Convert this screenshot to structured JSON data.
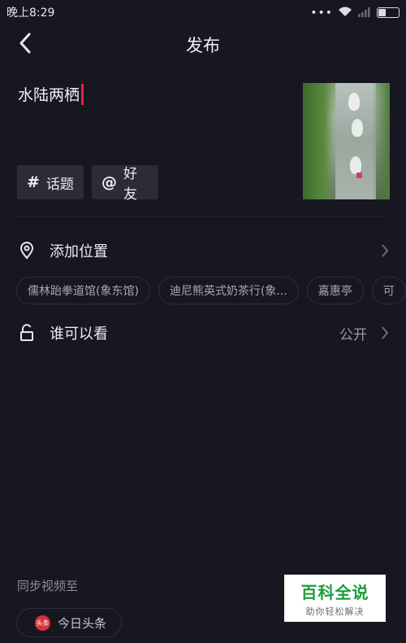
{
  "status_bar": {
    "time": "晚上8:29",
    "dots": "•••"
  },
  "header": {
    "title": "发布"
  },
  "caption": {
    "text": "水陆两栖"
  },
  "tags": {
    "topic_symbol": "#",
    "topic_label": "话题",
    "friend_symbol": "@",
    "friend_label": "好友"
  },
  "location": {
    "label": "添加位置",
    "suggestions": [
      "儒林跆拳道馆(象东馆)",
      "迪尼熊英式奶茶行(象...",
      "嘉惠亭",
      "可"
    ]
  },
  "visibility": {
    "label": "谁可以看",
    "value": "公开"
  },
  "sync": {
    "label": "同步视频至",
    "target": "今日头条",
    "logo_text": "头条"
  },
  "watermark": {
    "main": "百科全说",
    "sub": "助你轻松解决"
  },
  "colors": {
    "background": "#171722",
    "cursor": "#e4204b",
    "chip": "#2c2c38",
    "watermark_green": "#1e9d3a"
  }
}
